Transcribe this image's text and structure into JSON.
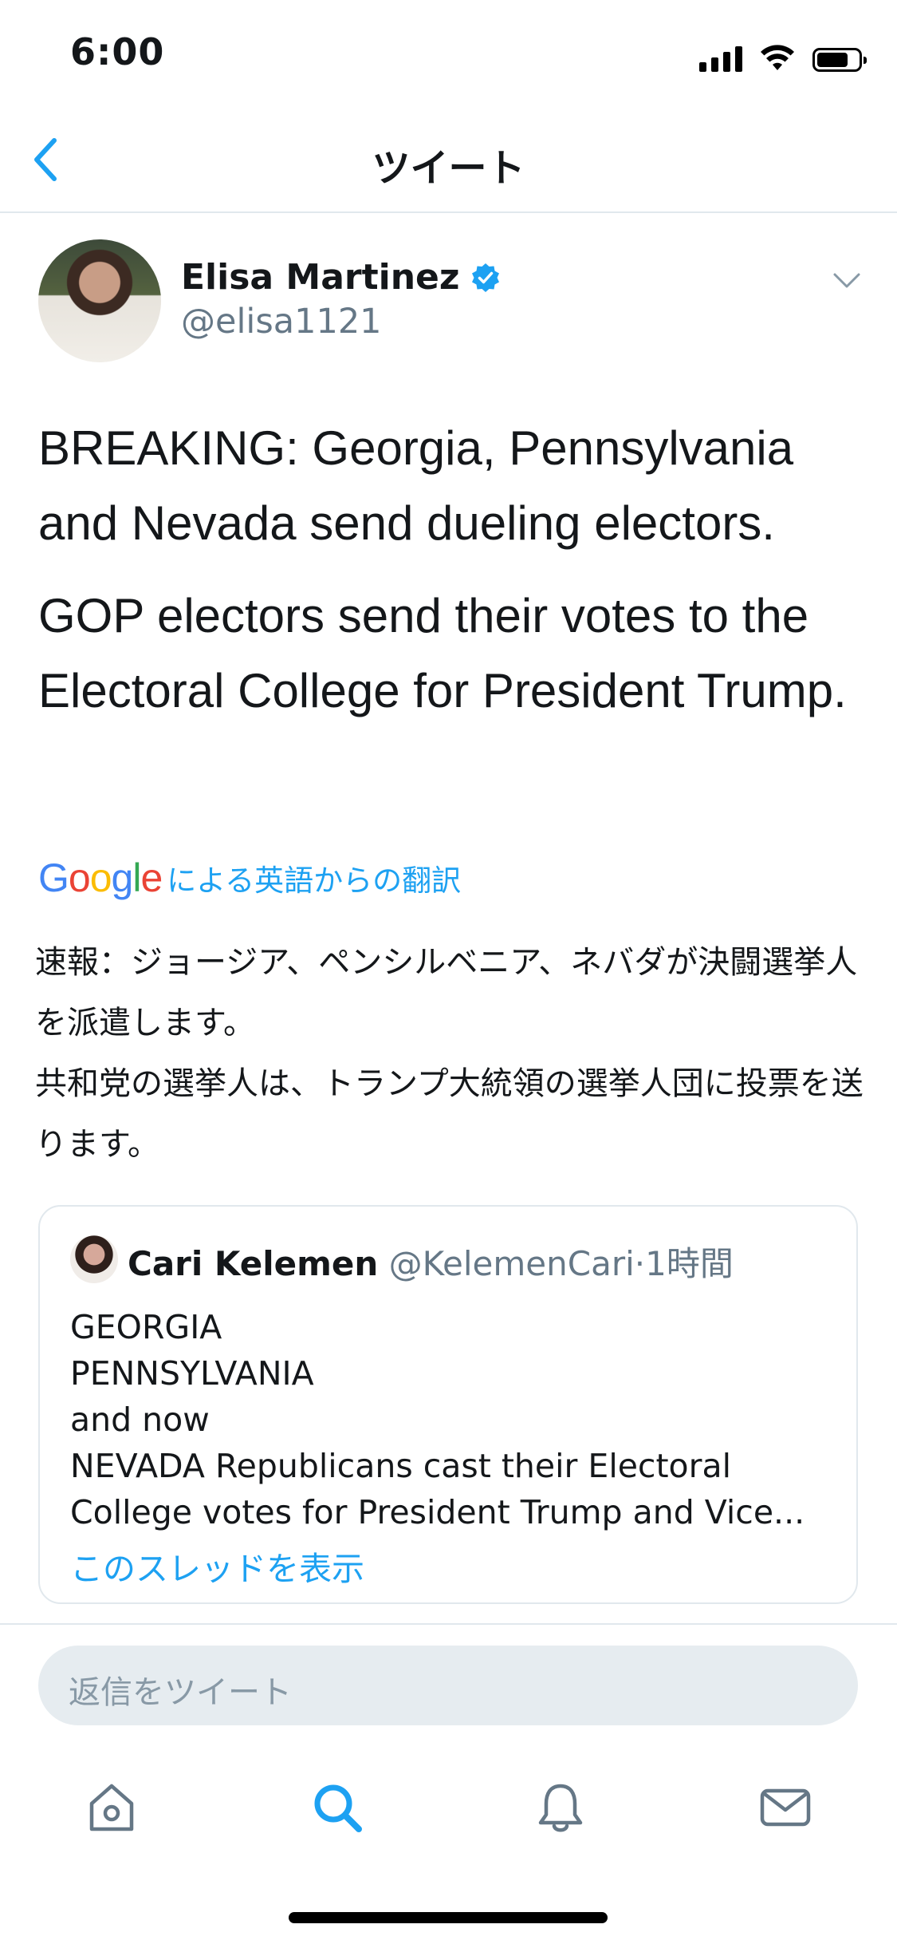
{
  "status_bar": {
    "time": "6:00"
  },
  "header": {
    "title": "ツイート"
  },
  "tweet": {
    "author_name": "Elisa Martinez",
    "handle": "@elisa1121",
    "paragraphs": [
      "BREAKING: Georgia, Pennsylvania and Nevada send dueling electors.",
      "GOP electors send their votes to the Electoral College for President Trump."
    ],
    "translation_label": "による英語からの翻訳",
    "translated_paragraphs": [
      "速報：ジョージア、ペンシルベニア、ネバダが決闘選挙人を派遣します。",
      "共和党の選挙人は、トランプ大統領の選挙人団に投票を送ります。"
    ]
  },
  "quoted_tweet": {
    "author_name": "Cari Kelemen",
    "handle": "@KelemenCari",
    "time": "1時間",
    "lines": [
      "GEORGIA",
      "PENNSYLVANIA",
      "and now",
      "NEVADA Republicans cast their Electoral",
      "College votes for President Trump and Vice..."
    ],
    "thread_link": "このスレッドを表示"
  },
  "reply": {
    "placeholder": "返信をツイート"
  },
  "tabs": [
    "home-icon",
    "search-icon",
    "notifications-icon",
    "messages-icon"
  ],
  "colors": {
    "accent": "#1da1f2",
    "secondary_text": "#657786",
    "divider": "#e1e8ed"
  }
}
